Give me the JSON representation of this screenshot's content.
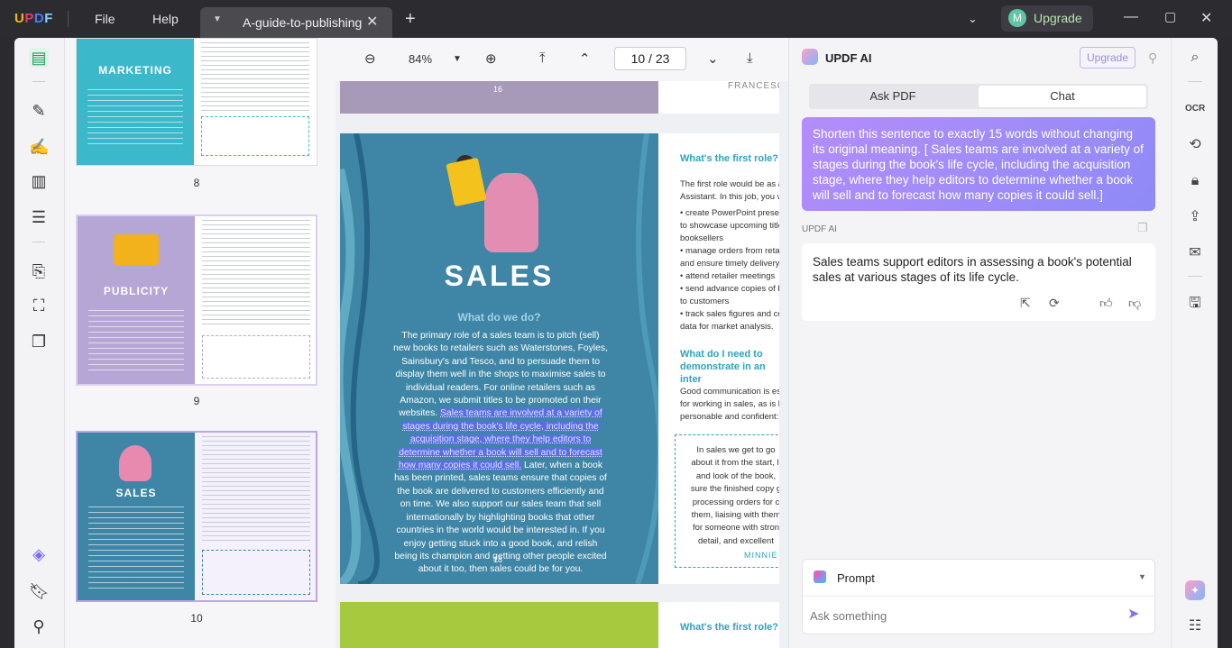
{
  "titlebar": {
    "logo": "UPDF",
    "menu_file": "File",
    "menu_help": "Help",
    "tab_title": "A-guide-to-publishing",
    "upgrade": "Upgrade",
    "avatar_letter": "M"
  },
  "thumbnails": {
    "pages": [
      {
        "number": "8",
        "title": "MARKETING",
        "color": "#3bb8c9"
      },
      {
        "number": "9",
        "title": "PUBLICITY",
        "color": "#b6a6d6"
      },
      {
        "number": "10",
        "title": "SALES",
        "color": "#3f86a6"
      }
    ]
  },
  "doc_toolbar": {
    "zoom": "84%",
    "page_current": "10",
    "page_sep": "/",
    "page_total": "23"
  },
  "document": {
    "prev_page_number": "16",
    "prev_page_author": "FRANCESCA",
    "page": {
      "title": "SALES",
      "subtitle": "What do we do?",
      "body_before": "The primary role of a sales team is to pitch (sell) new books to retailers such as Waterstones, Foyles, Sainsbury's and Tesco, and to persuade them to display them well in the shops to maximise sales to individual readers. For online retailers such as Amazon, we submit titles to be promoted on their websites. ",
      "body_highlight": "Sales teams are involved at a variety of stages during the book's life cycle, including the acquisition stage, where they help editors to determine whether a book will sell and to forecast how many copies it could sell.",
      "body_after": " Later, when a book has been printed, sales teams ensure that copies of the book are delivered to customers efficiently and on time. We also support our sales team that sell internationally by highlighting books that other countries in the world would be interested in. If you enjoy getting stuck into a good book, and relish being its champion and getting other people excited about it too, then sales could be for you.",
      "page_number": "18",
      "right_heading1": "What's the first role?",
      "right_p1": "The first role would be as a",
      "right_p2": "Assistant. In this job, you w",
      "bullets": [
        "• create PowerPoint presen",
        "to showcase upcoming titles",
        "booksellers",
        "• manage orders from reta",
        "and ensure timely delivery",
        "• attend retailer meetings",
        "• send advance copies of b",
        "to customers",
        "• track sales figures and co",
        "data for market analysis."
      ],
      "right_heading2": "What do I need to demonstrate in an inter",
      "right_p3": "Good communication is ess",
      "right_p4": "for working in sales, as is b",
      "right_p5": "personable and confident: y",
      "quote_lines": [
        "In sales we get to go",
        "about it from the start, li",
        "and look of the book,",
        "sure the finished copy g",
        "processing orders for c",
        "them, liaising with them",
        "for someone with stron",
        "detail, and excellent"
      ],
      "quote_author": "MINNIE",
      "next_heading": "What's the first role?"
    }
  },
  "ai": {
    "title": "UPDF AI",
    "upgrade": "Upgrade",
    "tab_ask_pdf": "Ask PDF",
    "tab_chat": "Chat",
    "user_message": "Shorten this sentence to exactly 15 words without changing its original meaning. [ Sales teams are involved at a variety of stages during the book's life cycle, including the acquisition stage, where they help editors to determine whether a book will sell and to forecast how many copies it could sell.]",
    "ai_label": "UPDF AI",
    "ai_message": "Sales teams support editors in assessing a book's potential sales at various stages of its life cycle.",
    "prompt_label": "Prompt",
    "input_placeholder": "Ask something"
  },
  "colors": {
    "accent": "#9b6cff",
    "sales_blue": "#3f86a6",
    "highlight": "#5a6ee0"
  }
}
